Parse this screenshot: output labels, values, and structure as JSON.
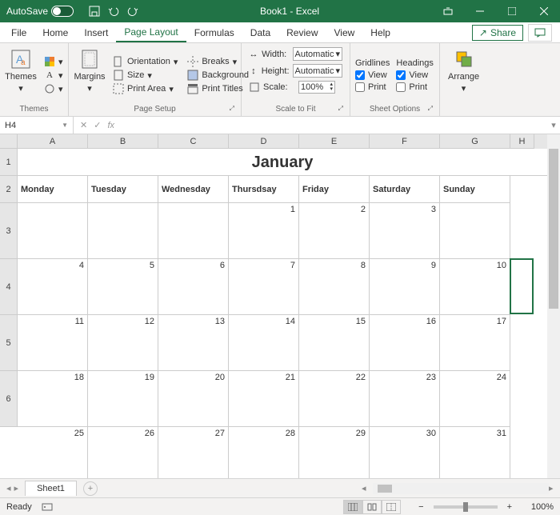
{
  "titlebar": {
    "autosave_label": "AutoSave",
    "autosave_state": "Off",
    "title": "Book1 - Excel"
  },
  "menu": {
    "tabs": [
      "File",
      "Home",
      "Insert",
      "Page Layout",
      "Formulas",
      "Data",
      "Review",
      "View",
      "Help"
    ],
    "active_index": 3,
    "share_label": "Share"
  },
  "ribbon": {
    "themes": {
      "label": "Themes",
      "btn": "Themes"
    },
    "page_setup": {
      "label": "Page Setup",
      "margins": "Margins",
      "orientation": "Orientation",
      "size": "Size",
      "print_area": "Print Area",
      "breaks": "Breaks",
      "background": "Background",
      "print_titles": "Print Titles"
    },
    "scale": {
      "label": "Scale to Fit",
      "width_lbl": "Width:",
      "height_lbl": "Height:",
      "scale_lbl": "Scale:",
      "width_val": "Automatic",
      "height_val": "Automatic",
      "scale_val": "100%"
    },
    "sheet_options": {
      "label": "Sheet Options",
      "gridlines": "Gridlines",
      "headings": "Headings",
      "view": "View",
      "print": "Print",
      "grid_view": true,
      "grid_print": false,
      "head_view": true,
      "head_print": false
    },
    "arrange": {
      "label": "Arrange",
      "btn": "Arrange"
    }
  },
  "namebox": {
    "ref": "H4"
  },
  "calendar": {
    "month": "January",
    "days": [
      "Monday",
      "Tuesday",
      "Wednesday",
      "Thursdsay",
      "Friday",
      "Saturday",
      "Sunday"
    ],
    "rows": [
      [
        "",
        "",
        "",
        "1",
        "2",
        "3",
        ""
      ],
      [
        "4",
        "5",
        "6",
        "7",
        "8",
        "9",
        "10"
      ],
      [
        "11",
        "12",
        "13",
        "14",
        "15",
        "16",
        "17"
      ],
      [
        "18",
        "19",
        "20",
        "21",
        "22",
        "23",
        "24"
      ],
      [
        "25",
        "26",
        "27",
        "28",
        "29",
        "30",
        "31"
      ]
    ]
  },
  "columns": [
    "A",
    "B",
    "C",
    "D",
    "E",
    "F",
    "G",
    "H"
  ],
  "row_nums": [
    "1",
    "2",
    "3",
    "4",
    "5",
    "6"
  ],
  "sheet": {
    "name": "Sheet1"
  },
  "status": {
    "ready": "Ready",
    "zoom": "100%"
  }
}
